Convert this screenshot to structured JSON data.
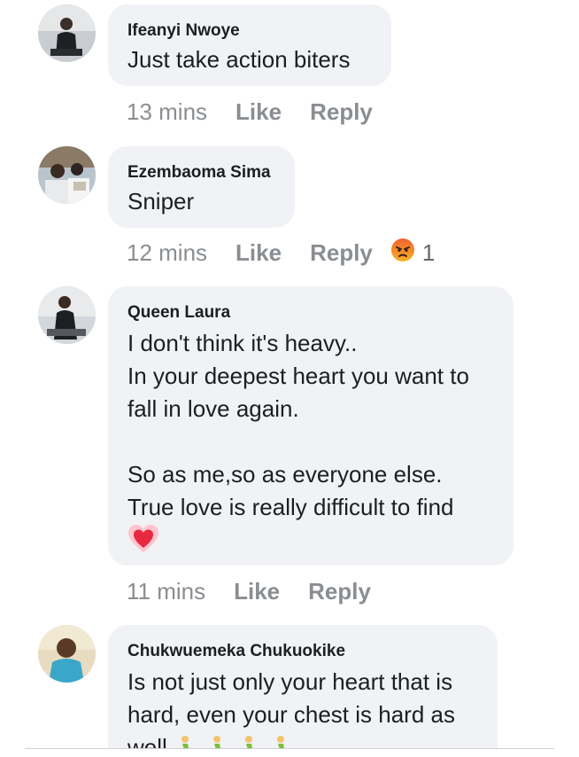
{
  "comments": [
    {
      "author": "Ifeanyi Nwoye",
      "text": "Just take action biters",
      "time": "13 mins",
      "like_label": "Like",
      "reply_label": "Reply"
    },
    {
      "author": "Ezembaoma Sima",
      "text": "Sniper",
      "time": "12 mins",
      "like_label": "Like",
      "reply_label": "Reply",
      "reaction": {
        "icon": "angry-reaction-icon",
        "count": "1"
      }
    },
    {
      "author": "Queen Laura",
      "text_lines": [
        "I don't think it's heavy..",
        "In your deepest heart you want to",
        "fall in love again.",
        "",
        "So as me,so as everyone else.",
        "True love is really difficult to find"
      ],
      "trailing_emoji": "heart-emoji-icon",
      "time": "11 mins",
      "like_label": "Like",
      "reply_label": "Reply"
    },
    {
      "author": "Chukwuemeka Chukuokike",
      "text_lines": [
        "Is not just only your heart that is",
        "hard, even your chest is hard as",
        "well"
      ],
      "trailing_emoji": "person-walking-emoji-icon"
    }
  ],
  "colors": {
    "bubble": "#f0f2f5",
    "meta_text": "#8a8d91",
    "angry_reaction": "#f0632f"
  }
}
